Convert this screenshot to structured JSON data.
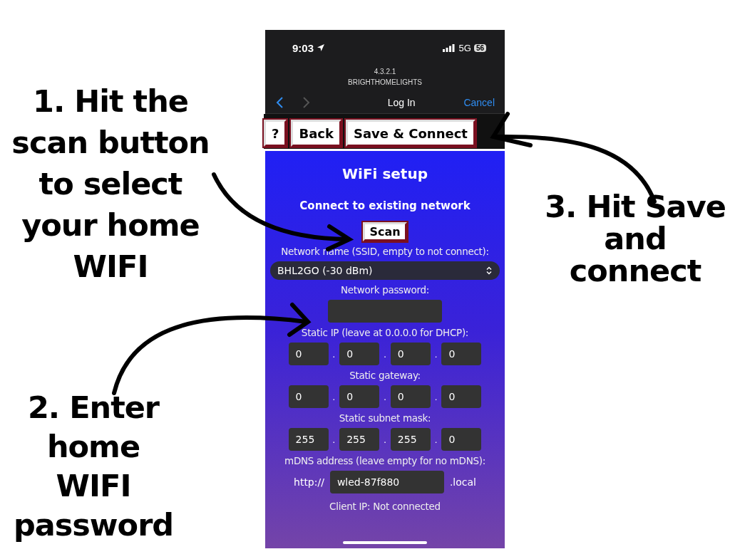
{
  "annotations_left": [
    {
      "kind": "step",
      "lines": [
        "1. Hit the",
        "scan button",
        "to select",
        "your home",
        "WIFI"
      ]
    },
    {
      "kind": "step",
      "lines": [
        "2. Enter",
        "home",
        "WIFI",
        "password"
      ]
    }
  ],
  "annotations_right": [
    {
      "kind": "step",
      "lines": [
        "3. Hit Save",
        "and",
        "connect"
      ]
    }
  ],
  "phone": {
    "status_bar": {
      "time": "9:03",
      "network": "5G",
      "battery": "56"
    },
    "browser": {
      "address": "4.3.2.1",
      "site": "BRIGHTHOMELIGHTS",
      "title": "Log In",
      "back_enabled": true,
      "forward_enabled": false,
      "cancel": "Cancel"
    },
    "toolbar": [
      "?",
      "Back",
      "Save & Connect"
    ],
    "form": {
      "heading": "WiFi setup",
      "subheading": "Connect to existing network",
      "scan": "Scan",
      "ssid_label": "Network name (SSID, empty to not connect):",
      "ssid_value": "BHL2GO (-30 dBm)",
      "password_label": "Network password:",
      "ip_groups": [
        {
          "label": "Static IP (leave at 0.0.0.0 for DHCP):",
          "octets": [
            "0",
            "0",
            "0",
            "0"
          ]
        },
        {
          "label": "Static gateway:",
          "octets": [
            "0",
            "0",
            "0",
            "0"
          ]
        },
        {
          "label": "Static subnet mask:",
          "octets": [
            "255",
            "255",
            "255",
            "0"
          ]
        }
      ],
      "separator": ".",
      "mdns_label": "mDNS address (leave empty for no mDNS):",
      "mdns_prefix": "http://",
      "mdns_value": "wled-87f880",
      "mdns_suffix": ".local",
      "client_ip": "Client IP: Not connected"
    }
  }
}
